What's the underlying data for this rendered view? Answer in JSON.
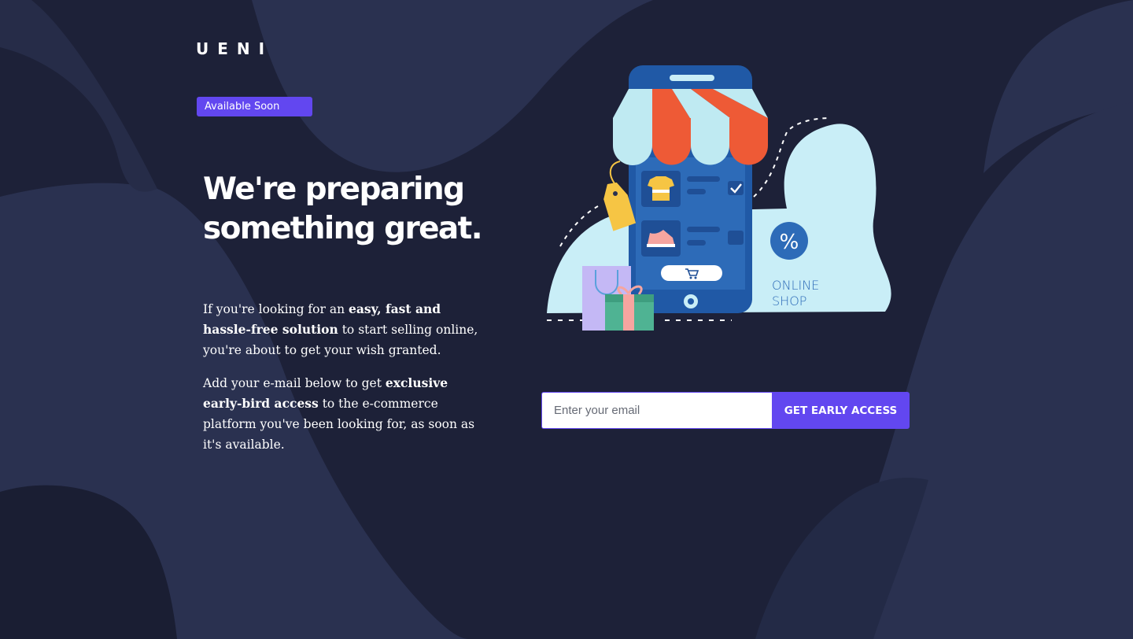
{
  "brand": {
    "logo_text": "UENI"
  },
  "badge": {
    "label": "Available Soon"
  },
  "hero": {
    "headline_line1": "We're preparing",
    "headline_line2": "something great."
  },
  "intro": {
    "p1_start": "If you're looking for an ",
    "p1_bold": "easy, fast and hassle-free solution",
    "p1_end": " to start selling online, you're about to get your wish granted.",
    "p2_start": "Add your e-mail below to get ",
    "p2_bold": "exclusive early-bird access",
    "p2_end": " to the e-commerce platform you've been looking for, as soon as it's available."
  },
  "illustration": {
    "percent_symbol": "%",
    "caption_line1": "ONLINE",
    "caption_line2": "SHOP",
    "icons": [
      "phone-store-icon",
      "awning-icon",
      "price-tag-icon",
      "tshirt-icon",
      "sneaker-icon",
      "cart-icon",
      "shopping-bag-icon",
      "gift-box-icon",
      "percent-badge-icon",
      "checkmark-icon"
    ]
  },
  "signup": {
    "email_placeholder": "Enter your email",
    "email_value": "",
    "button_label": "GET EARLY ACCESS"
  },
  "colors": {
    "background": "#1d2138",
    "background_shape": "#2a3150",
    "accent": "#6247f0",
    "phone": "#2d6bb8",
    "awning_red": "#ee5a36",
    "awning_light": "#bfeaf2",
    "blob": "#c9eef7"
  }
}
